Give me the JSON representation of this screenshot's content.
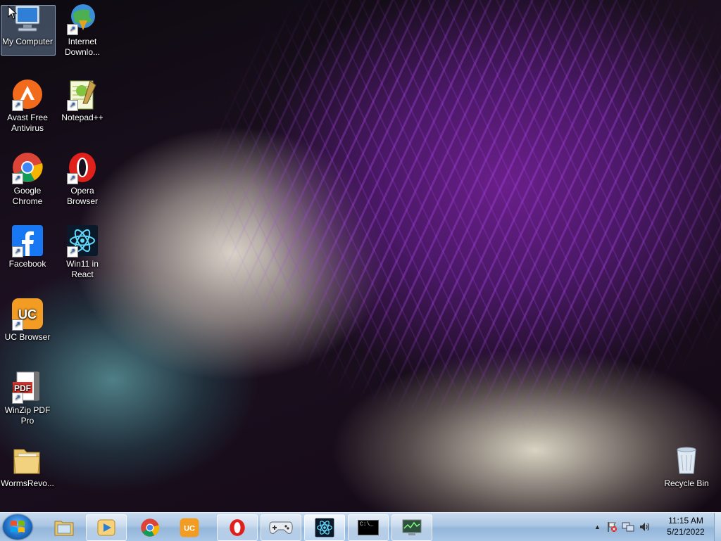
{
  "desktop": {
    "icons": [
      {
        "label": "My Computer",
        "icon": "computer-icon"
      },
      {
        "label": "Internet Downlo...",
        "icon": "internet-download-manager-icon"
      },
      {
        "label": "Avast Free Antivirus",
        "icon": "avast-icon"
      },
      {
        "label": "Notepad++",
        "icon": "notepad-plus-plus-icon"
      },
      {
        "label": "Google Chrome",
        "icon": "chrome-icon"
      },
      {
        "label": "Opera Browser",
        "icon": "opera-icon"
      },
      {
        "label": "Facebook",
        "icon": "facebook-icon"
      },
      {
        "label": "Win11 in React",
        "icon": "react-icon"
      },
      {
        "label": "UC Browser",
        "icon": "uc-browser-icon"
      },
      {
        "label": "WinZip PDF Pro",
        "icon": "winzip-pdf-icon"
      },
      {
        "label": "WormsRevo...",
        "icon": "folder-icon"
      },
      {
        "label": "Recycle Bin",
        "icon": "recycle-bin-icon"
      }
    ],
    "selected": "My Computer"
  },
  "taskbar": {
    "items": [
      {
        "name": "windows-explorer",
        "icon": "folder-icon"
      },
      {
        "name": "media-player",
        "icon": "media-player-icon"
      },
      {
        "name": "chrome",
        "icon": "chrome-icon"
      },
      {
        "name": "uc-browser",
        "icon": "uc-browser-icon"
      },
      {
        "name": "opera",
        "icon": "opera-icon"
      },
      {
        "name": "game-controller",
        "icon": "gamepad-icon"
      },
      {
        "name": "win11-react",
        "icon": "react-icon"
      },
      {
        "name": "command-prompt",
        "icon": "terminal-icon",
        "text": "C:\\_"
      },
      {
        "name": "system-monitor",
        "icon": "monitor-icon"
      }
    ],
    "clock": {
      "time": "11:15 AM",
      "date": "5/21/2022"
    }
  },
  "colors": {
    "taskbar": "#a9c5e3",
    "selection": "#96bee6",
    "avast": "#f26b1d",
    "facebook": "#1877f2",
    "opera": "#e0201b",
    "react_bg": "#0b1a2a",
    "react": "#61dafb"
  }
}
